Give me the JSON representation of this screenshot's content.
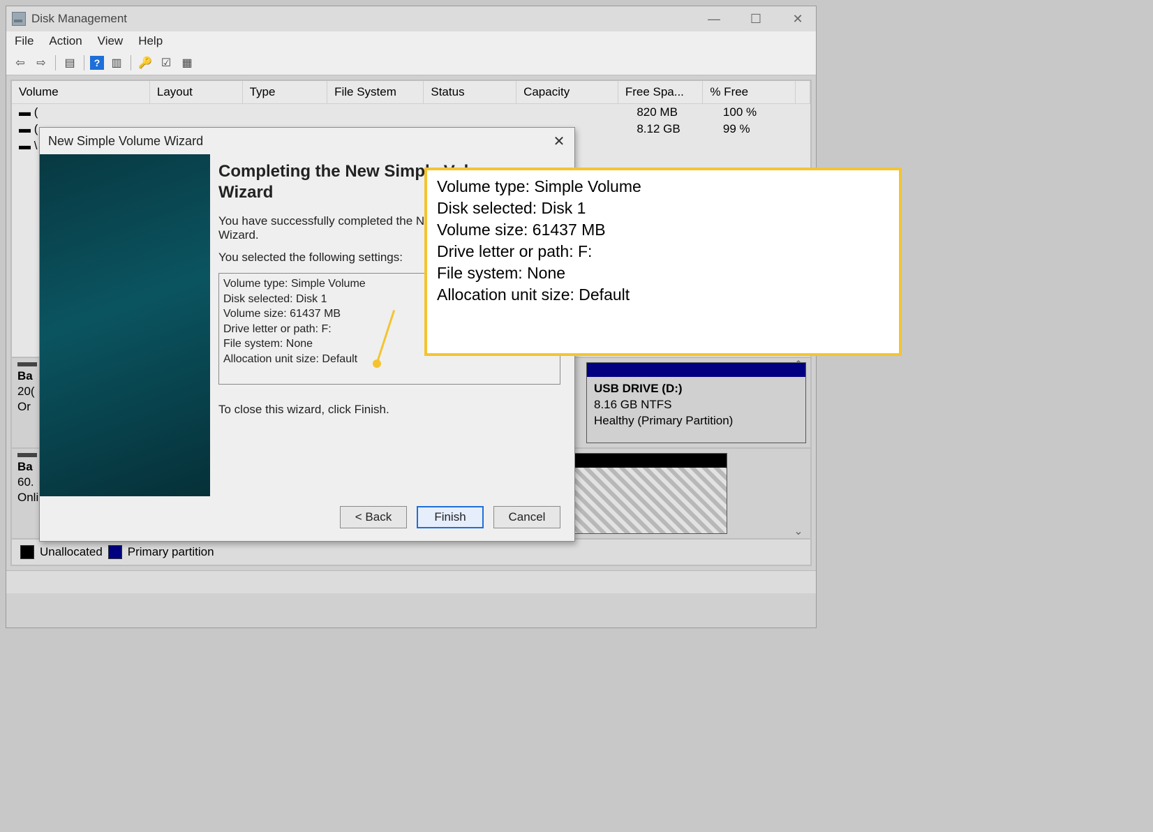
{
  "window": {
    "title": "Disk Management",
    "menu": {
      "file": "File",
      "action": "Action",
      "view": "View",
      "help": "Help"
    }
  },
  "columns": {
    "volume": "Volume",
    "layout": "Layout",
    "type": "Type",
    "fs": "File System",
    "status": "Status",
    "capacity": "Capacity",
    "free": "Free Spa...",
    "pct": "% Free"
  },
  "rows": [
    {
      "free": "820 MB",
      "pct": "100 %"
    },
    {
      "free": "8.12 GB",
      "pct": "99 %"
    }
  ],
  "disk_a": {
    "label": "Ba",
    "size": "20(",
    "status": "Or",
    "part": {
      "name": "USB DRIVE  (D:)",
      "line2": "8.16 GB NTFS",
      "line3": "Healthy (Primary Partition)"
    }
  },
  "disk_b": {
    "label": "Ba",
    "size": "60.",
    "status": "Online",
    "part": {
      "name": "Unallocated"
    }
  },
  "legend": {
    "unalloc": "Unallocated",
    "primary": "Primary partition"
  },
  "wizard": {
    "title": "New Simple Volume Wizard",
    "heading": "Completing the New Simple Volume Wizard",
    "p1": "You have successfully completed the New Simple Volume Wizard.",
    "p2": "You selected the following settings:",
    "settings": {
      "l1": "Volume type: Simple Volume",
      "l2": "Disk selected: Disk 1",
      "l3": "Volume size: 61437 MB",
      "l4": "Drive letter or path: F:",
      "l5": "File system: None",
      "l6": "Allocation unit size: Default"
    },
    "p3": "To close this wizard, click Finish.",
    "btn_back": "< Back",
    "btn_finish": "Finish",
    "btn_cancel": "Cancel"
  },
  "callout": {
    "l1": "Volume type: Simple Volume",
    "l2": "Disk selected: Disk 1",
    "l3": "Volume size: 61437 MB",
    "l4": "Drive letter or path: F:",
    "l5": "File system: None",
    "l6": "Allocation unit size: Default"
  }
}
